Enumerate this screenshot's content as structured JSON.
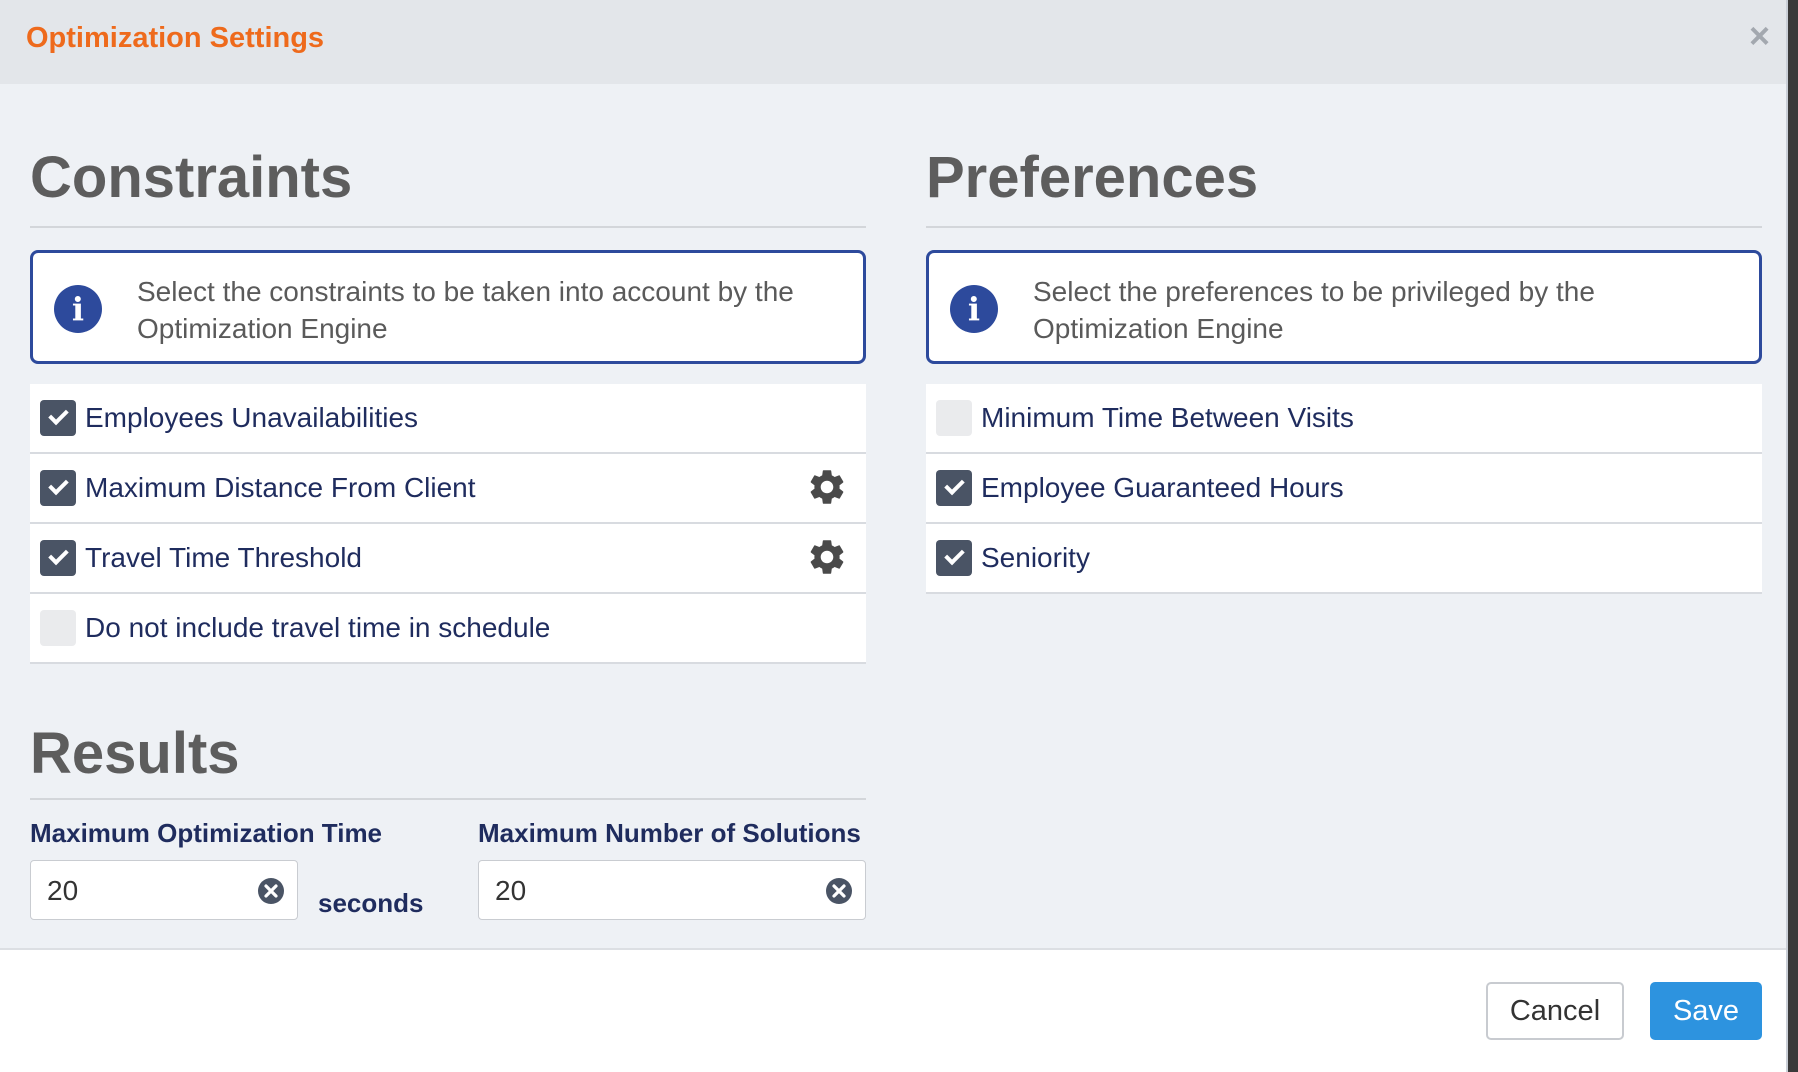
{
  "dialog": {
    "title": "Optimization Settings",
    "close_glyph": "×"
  },
  "constraints": {
    "heading": "Constraints",
    "info_text": "Select the constraints to be taken into account by the Optimization Engine",
    "items": [
      {
        "label": "Employees Unavailabilities",
        "checked": true,
        "has_settings": false
      },
      {
        "label": "Maximum Distance From Client",
        "checked": true,
        "has_settings": true
      },
      {
        "label": "Travel Time Threshold",
        "checked": true,
        "has_settings": true
      },
      {
        "label": "Do not include travel time in schedule",
        "checked": false,
        "has_settings": false
      }
    ]
  },
  "preferences": {
    "heading": "Preferences",
    "info_text": "Select the preferences to be privileged by the Optimization Engine",
    "items": [
      {
        "label": "Minimum Time Between Visits",
        "checked": false
      },
      {
        "label": "Employee Guaranteed Hours",
        "checked": true
      },
      {
        "label": "Seniority",
        "checked": true
      }
    ]
  },
  "results": {
    "heading": "Results",
    "max_time": {
      "label": "Maximum Optimization Time",
      "value": "20",
      "unit": "seconds"
    },
    "max_solutions": {
      "label": "Maximum Number of Solutions",
      "value": "20"
    }
  },
  "footer": {
    "cancel_label": "Cancel",
    "save_label": "Save"
  },
  "colors": {
    "title": "#ee6a1c",
    "accent_blue": "#2d4a9c",
    "save_button": "#2d93df",
    "checkbox_checked": "#4a5465"
  },
  "icons": {
    "info": "info-circle-icon",
    "gear": "gear-icon",
    "clear": "clear-circle-icon",
    "close": "close-icon"
  }
}
